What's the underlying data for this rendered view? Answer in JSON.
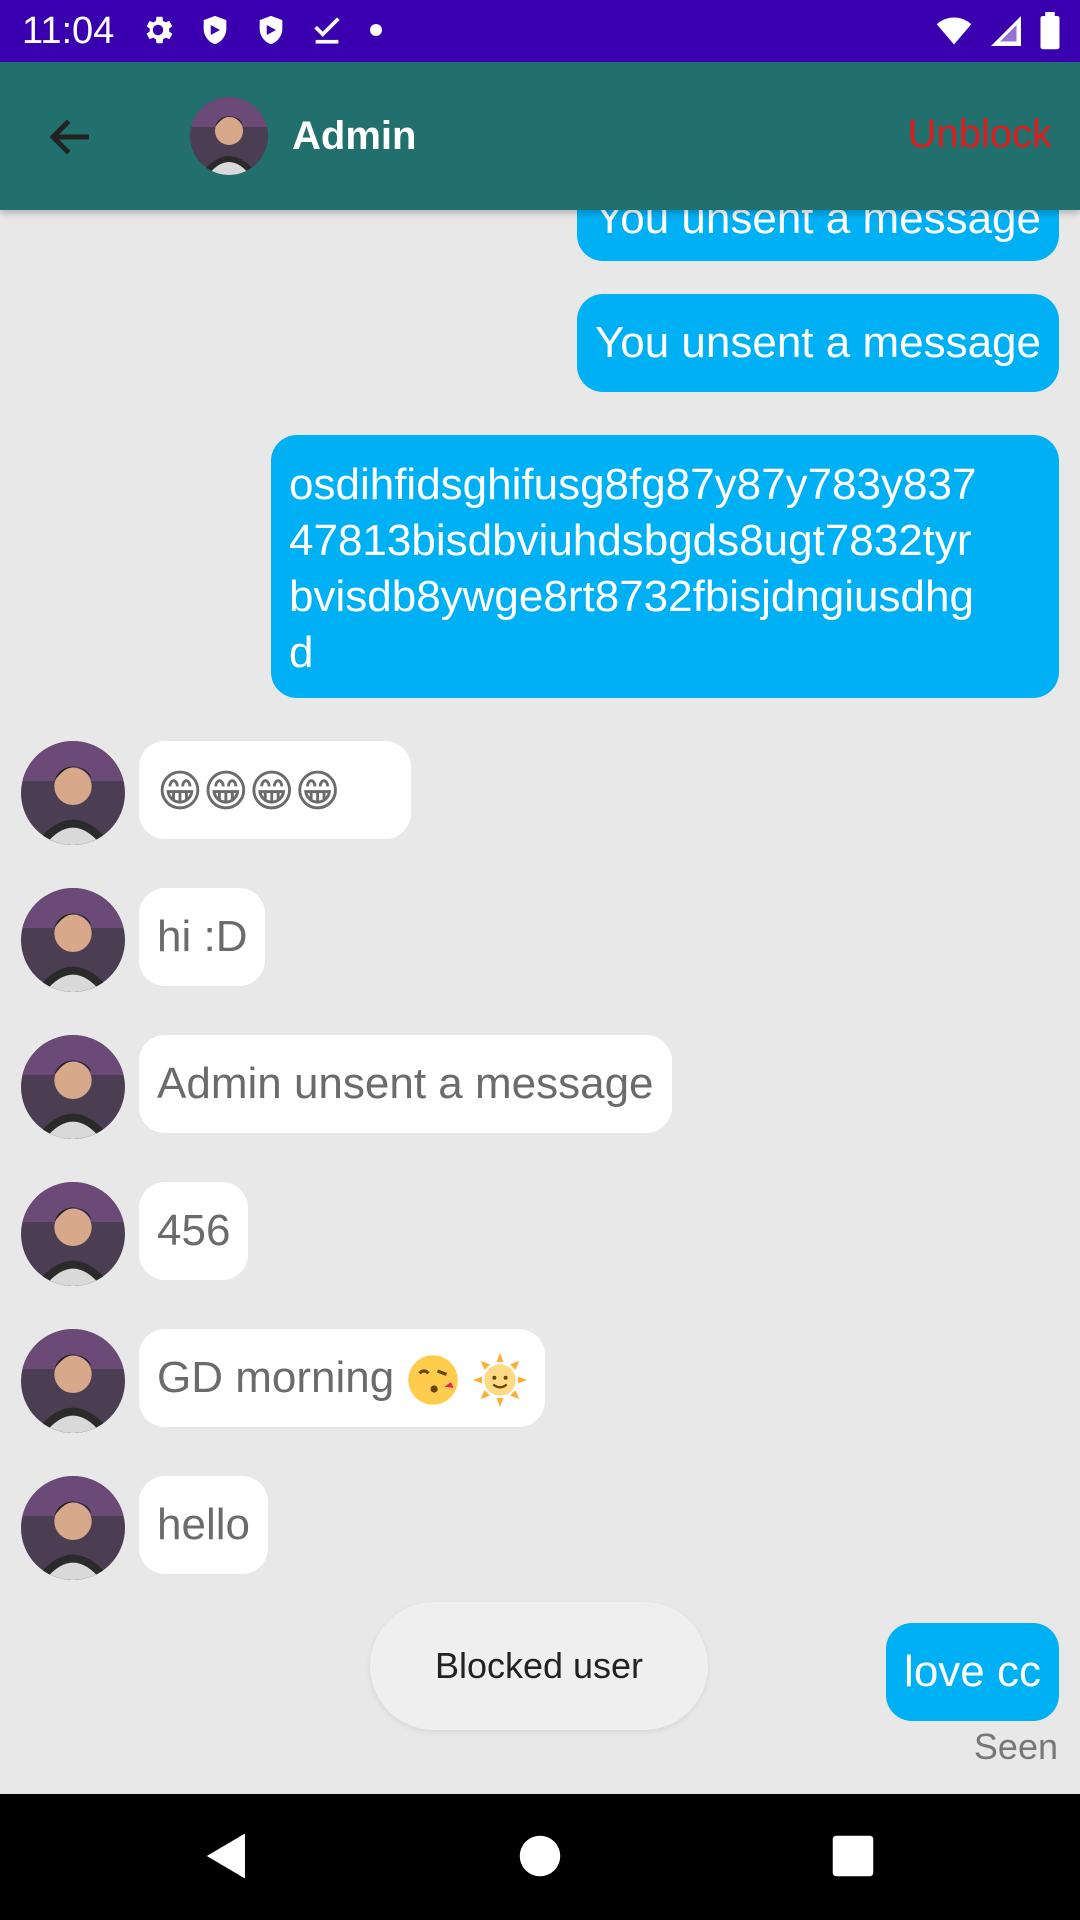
{
  "status_bar": {
    "time": "11:04"
  },
  "header": {
    "title": "Admin",
    "unblock_label": "Unblock"
  },
  "messages": {
    "out_0": "You unsent a message",
    "out_1": "You unsent a message",
    "out_2_lines": [
      "osdihfidsghifusg8fg87y87y783y837",
      "47813bisdbviuhdsbgds8ugt7832tyr",
      "bvisdb8ywge8rt8732fbisjdngiusdhg",
      "d"
    ],
    "in_0": "😁😁😁😁",
    "in_1": "hi :D",
    "in_2": "Admin unsent a message",
    "in_3": "456",
    "in_4": "GD morning",
    "in_5": "hello",
    "out_last": "love cc",
    "seen": "Seen"
  },
  "toast": {
    "text": "Blocked user"
  },
  "colors": {
    "status_bar": "#3a00b0",
    "app_bar": "#22706e",
    "outgoing_bubble": "#00b0f5",
    "incoming_bubble": "#ffffff",
    "unblock": "#e01b1b",
    "background": "#e8e8e8"
  },
  "icons": {
    "status_left": [
      "settings-icon",
      "shield-icon",
      "shield-icon",
      "download-done-icon",
      "dot-icon"
    ],
    "status_right": [
      "wifi-icon",
      "signal-icon",
      "battery-icon"
    ],
    "nav": [
      "back-triangle-icon",
      "home-circle-icon",
      "recents-square-icon"
    ]
  }
}
